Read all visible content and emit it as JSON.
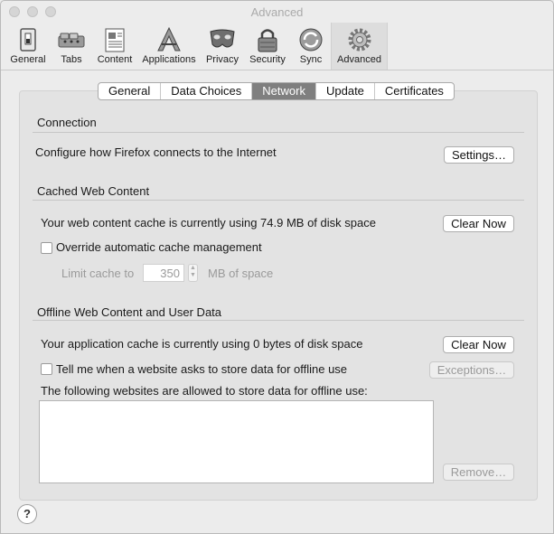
{
  "window": {
    "title": "Advanced"
  },
  "toolbar": {
    "items": [
      {
        "label": "General",
        "icon": "switch-icon"
      },
      {
        "label": "Tabs",
        "icon": "tabs-icon"
      },
      {
        "label": "Content",
        "icon": "content-icon"
      },
      {
        "label": "Applications",
        "icon": "applications-icon"
      },
      {
        "label": "Privacy",
        "icon": "mask-icon"
      },
      {
        "label": "Security",
        "icon": "lock-icon"
      },
      {
        "label": "Sync",
        "icon": "sync-icon"
      },
      {
        "label": "Advanced",
        "icon": "gear-icon",
        "active": true
      }
    ]
  },
  "tabs": [
    {
      "label": "General"
    },
    {
      "label": "Data Choices"
    },
    {
      "label": "Network",
      "selected": true
    },
    {
      "label": "Update"
    },
    {
      "label": "Certificates"
    }
  ],
  "connection": {
    "heading": "Connection",
    "description": "Configure how Firefox connects to the Internet",
    "settings_button": "Settings…"
  },
  "cache": {
    "heading": "Cached Web Content",
    "usage_text": "Your web content cache is currently using 74.9 MB of disk space",
    "clear_button": "Clear Now",
    "override_label": "Override automatic cache management",
    "override_checked": false,
    "limit_label": "Limit cache to",
    "limit_value": "350",
    "limit_unit": "MB of space"
  },
  "offline": {
    "heading": "Offline Web Content and User Data",
    "usage_text": "Your application cache is currently using 0 bytes of disk space",
    "clear_button": "Clear Now",
    "tell_me_label": "Tell me when a website asks to store data for offline use",
    "tell_me_checked": false,
    "exceptions_button": "Exceptions…",
    "list_label": "The following websites are allowed to store data for offline use:",
    "remove_button": "Remove…"
  },
  "help": {
    "label": "?"
  }
}
